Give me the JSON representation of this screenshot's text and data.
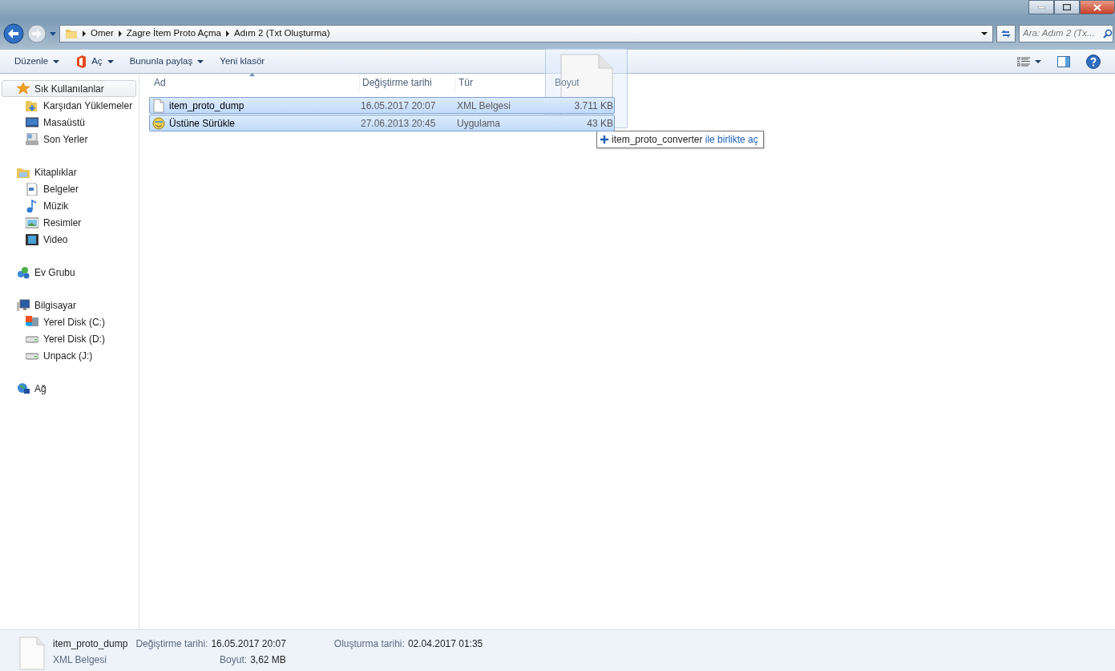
{
  "address": {
    "breadcrumbs": [
      "Omer",
      "Zagre İtem Proto Açma",
      "Adım 2 (Txt Oluşturma)"
    ]
  },
  "search": {
    "placeholder": "Ara: Adım 2 (Tx..."
  },
  "toolbar": {
    "buttons": [
      {
        "label": "Düzenle",
        "kind": "menu"
      },
      {
        "label": "Aç",
        "kind": "app-menu"
      },
      {
        "label": "Bununla paylaş",
        "kind": "menu"
      },
      {
        "label": "Yeni klasör",
        "kind": "plain"
      }
    ]
  },
  "sidebar": {
    "groups": [
      {
        "label": "Sık Kullanılanlar",
        "selected": true,
        "children": [
          {
            "label": "Karşıdan Yüklemeler"
          },
          {
            "label": "Masaüstü"
          },
          {
            "label": "Son Yerler"
          }
        ]
      },
      {
        "label": "Kitaplıklar",
        "selected": false,
        "children": [
          {
            "label": "Belgeler"
          },
          {
            "label": "Müzik"
          },
          {
            "label": "Resimler"
          },
          {
            "label": "Video"
          }
        ]
      },
      {
        "label": "Ev Grubu",
        "selected": false
      },
      {
        "label": "Bilgisayar",
        "selected": false,
        "children": [
          {
            "label": "Yerel Disk (C:)"
          },
          {
            "label": "Yerel Disk (D:)"
          },
          {
            "label": "Unpack (J:)"
          }
        ]
      },
      {
        "label": "Ağ",
        "selected": false
      }
    ]
  },
  "table": {
    "columns": [
      "Ad",
      "Değiştirme tarihi",
      "Tür",
      "Boyut"
    ],
    "rows": [
      {
        "kind": "document",
        "selected": true,
        "cells": [
          "item_proto_dump",
          "16.05.2017 20:07",
          "XML Belgesi",
          "3.711 KB"
        ]
      },
      {
        "kind": "app",
        "selected": true,
        "cells": [
          "Üstüne Sürükle",
          "27.06.2013 20:45",
          "Uygulama",
          "43 KB"
        ]
      }
    ]
  },
  "drag": {
    "target": "item_proto_converter",
    "action": "ile birlikte aç"
  },
  "details": {
    "name": "item_proto_dump",
    "type": "XML Belgesi",
    "fields": [
      {
        "label": "Değiştirme tarihi:",
        "value": "16.05.2017 20:07"
      },
      {
        "label": "Boyut:",
        "value": "3,62 MB"
      },
      {
        "label": "Oluşturma tarihi:",
        "value": "02.04.2017 01:35"
      }
    ]
  }
}
